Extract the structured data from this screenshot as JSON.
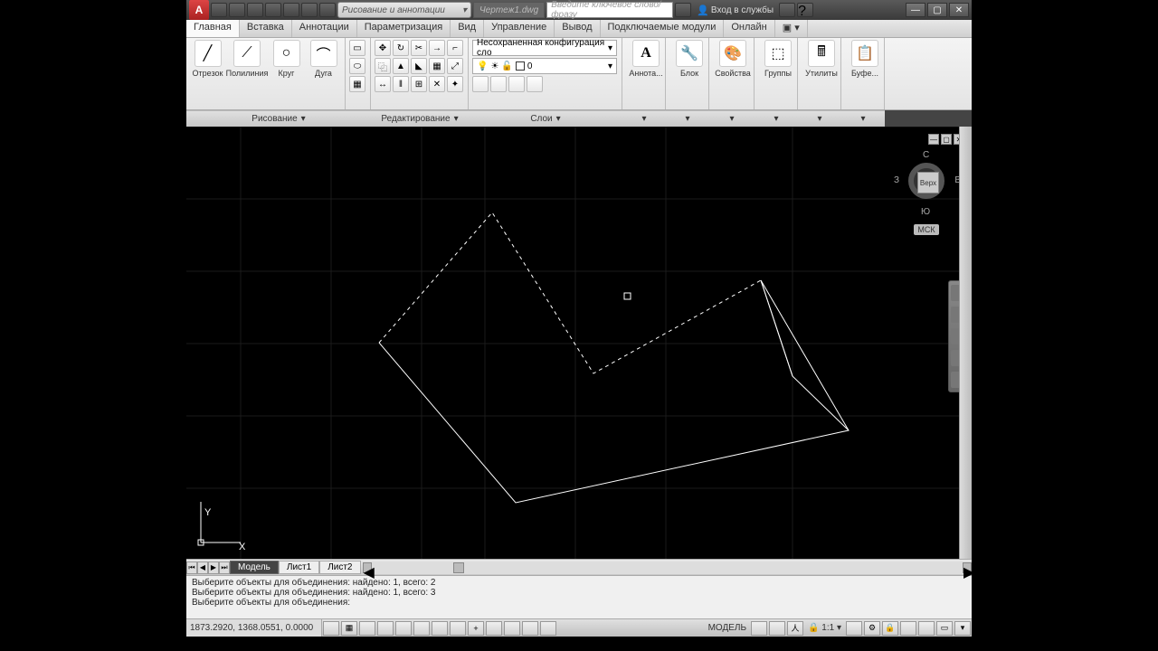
{
  "titlebar": {
    "logo": "A",
    "workspace": "Рисование и аннотации",
    "doc": "Чертеж1.dwg",
    "search_placeholder": "Введите ключевое слово/фразу",
    "signin": "Вход в службы"
  },
  "menu": {
    "tabs": [
      "Главная",
      "Вставка",
      "Аннотации",
      "Параметризация",
      "Вид",
      "Управление",
      "Вывод",
      "Подключаемые модули",
      "Онлайн"
    ],
    "active": 0
  },
  "ribbon": {
    "draw": {
      "title": "Рисование",
      "tools": [
        {
          "label": "Отрезок"
        },
        {
          "label": "Полилиния"
        },
        {
          "label": "Круг"
        },
        {
          "label": "Дуга"
        }
      ]
    },
    "edit": {
      "title": "Редактирование"
    },
    "layers": {
      "title": "Слои",
      "current": "Несохраненная конфигурация сло",
      "layer0": "0"
    },
    "annotation": {
      "label": "Аннота..."
    },
    "block": {
      "label": "Блок"
    },
    "properties": {
      "label": "Свойства"
    },
    "groups": {
      "label": "Группы"
    },
    "utilities": {
      "label": "Утилиты"
    },
    "clipboard": {
      "label": "Буфе..."
    }
  },
  "viewcube": {
    "top": "С",
    "left": "З",
    "right": "В",
    "bottom": "Ю",
    "face": "Верх",
    "ucs": "МСК"
  },
  "axes": {
    "x": "X",
    "y": "Y"
  },
  "tabs": {
    "model": "Модель",
    "sheet1": "Лист1",
    "sheet2": "Лист2"
  },
  "cmd": {
    "line1": "Выберите объекты для объединения: найдено: 1, всего: 2",
    "line2": "Выберите объекты для объединения: найдено: 1, всего: 3",
    "line3": "",
    "prompt": "Выберите объекты для объединения:"
  },
  "status": {
    "coords": "1873.2920, 1368.0551, 0.0000",
    "model": "МОДЕЛЬ",
    "scale": "1:1"
  }
}
